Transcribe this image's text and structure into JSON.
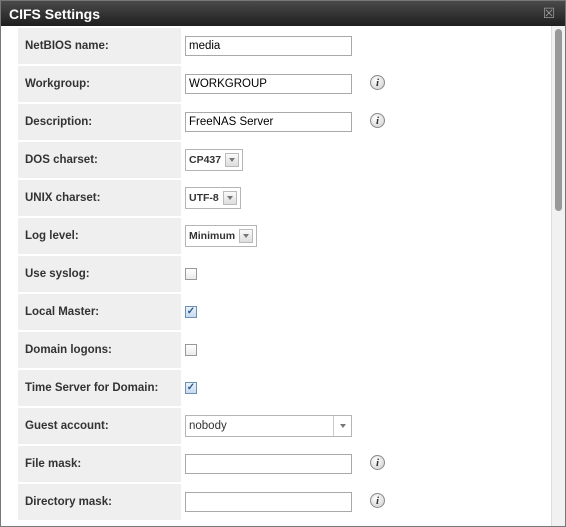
{
  "dialog": {
    "title": "CIFS Settings",
    "close_glyph": "☒"
  },
  "fields": {
    "netbios": {
      "label": "NetBIOS name:",
      "value": "media"
    },
    "workgroup": {
      "label": "Workgroup:",
      "value": "WORKGROUP"
    },
    "description": {
      "label": "Description:",
      "value": "FreeNAS Server"
    },
    "dos_charset": {
      "label": "DOS charset:",
      "value": "CP437"
    },
    "unix_charset": {
      "label": "UNIX charset:",
      "value": "UTF-8"
    },
    "log_level": {
      "label": "Log level:",
      "value": "Minimum"
    },
    "use_syslog": {
      "label": "Use syslog:",
      "checked": false
    },
    "local_master": {
      "label": "Local Master:",
      "checked": true
    },
    "domain_logons": {
      "label": "Domain logons:",
      "checked": false
    },
    "time_server": {
      "label": "Time Server for Domain:",
      "checked": true
    },
    "guest_account": {
      "label": "Guest account:",
      "value": "nobody"
    },
    "file_mask": {
      "label": "File mask:",
      "value": ""
    },
    "directory_mask": {
      "label": "Directory mask:",
      "value": ""
    }
  },
  "icons": {
    "info": "info-icon",
    "close": "close-icon",
    "checkmark": "checkmark-icon",
    "dropdown": "dropdown-arrow-icon"
  }
}
